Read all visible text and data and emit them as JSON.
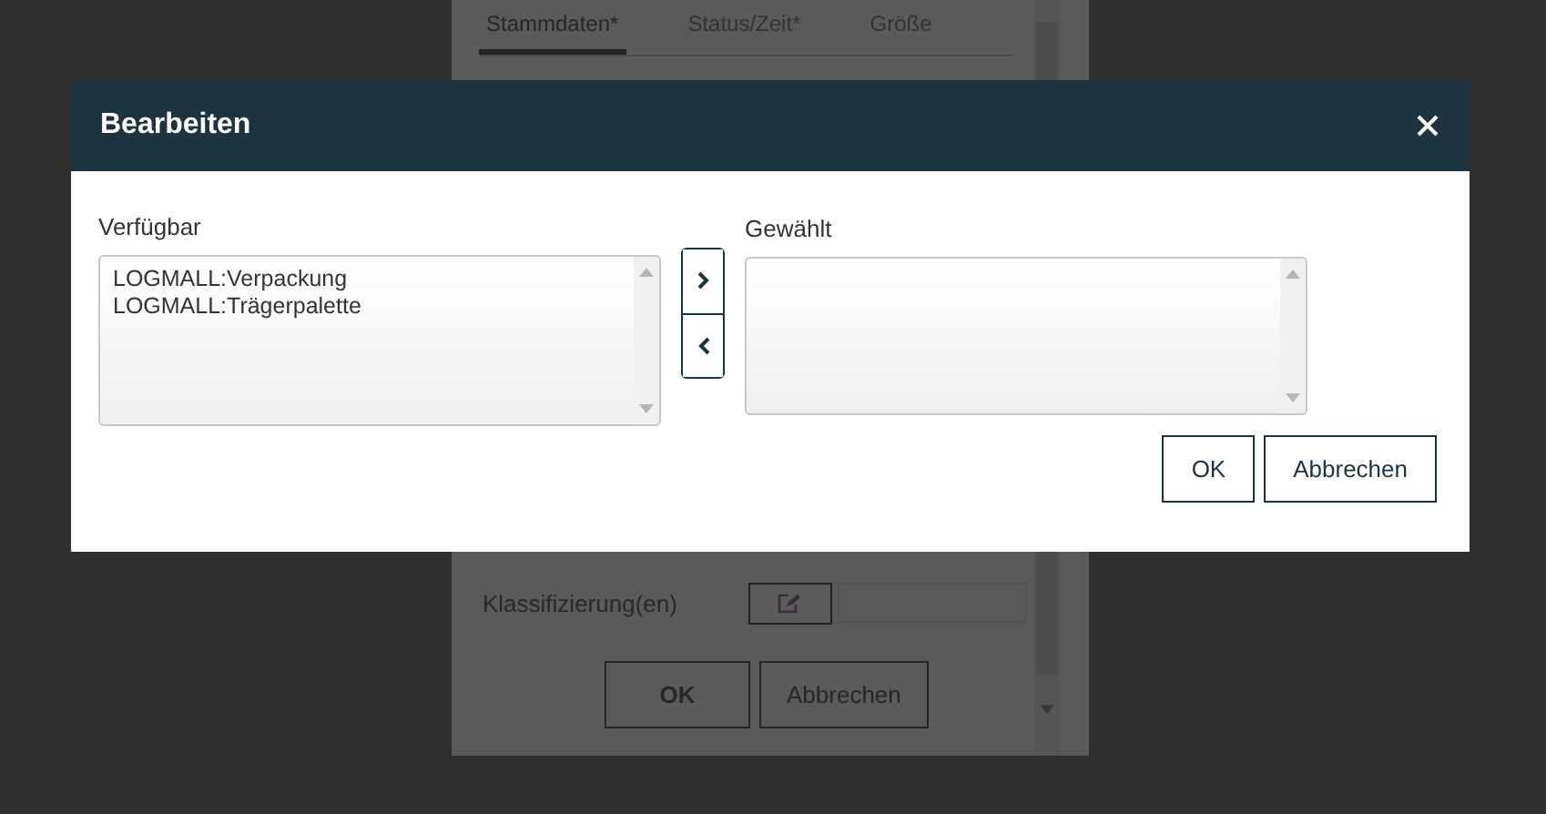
{
  "background_form": {
    "tabs": [
      {
        "label": "Stammdaten*",
        "selected": true
      },
      {
        "label": "Status/Zeit*",
        "selected": false
      },
      {
        "label": "Größe",
        "selected": false
      }
    ],
    "classification_label": "Klassifizierung(en)",
    "buttons": [
      "OK",
      "Abbrechen"
    ]
  },
  "dialog": {
    "title": "Bearbeiten",
    "available": {
      "label": "Verfügbar",
      "items": [
        "LOGMALL:Verpackung",
        "LOGMALL:Trägerpalette"
      ]
    },
    "chosen": {
      "label": "Gewählt"
    },
    "buttons": [
      "OK",
      "Abbrechen"
    ]
  }
}
